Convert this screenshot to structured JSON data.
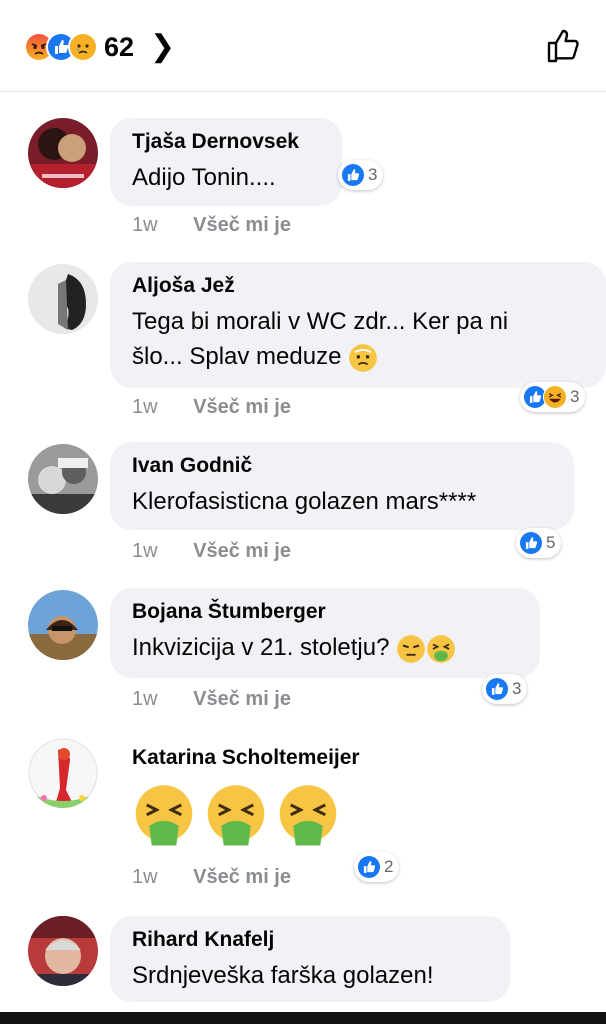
{
  "header": {
    "reaction_icons": [
      "angry-icon",
      "like-icon",
      "sad-icon"
    ],
    "reaction_count": "62",
    "chevron": "❯",
    "like_action_icon": "thumbs-up-outline-icon"
  },
  "comments": [
    {
      "name": "Tjaša Dernovsek",
      "text": "Adijo Tonin....",
      "time": "1w",
      "like_label": "Všeč mi je",
      "reactions": [
        "like-icon"
      ],
      "reaction_count": "3"
    },
    {
      "name": "Aljoša Jež",
      "text_line1": "Tega bi morali v WC zdr... Ker pa ni",
      "text_line2": "šlo... Splav meduze",
      "time": "1w",
      "like_label": "Všeč mi je",
      "reactions": [
        "like-icon",
        "laugh-icon"
      ],
      "reaction_count": "3"
    },
    {
      "name": "Ivan Godnič",
      "text": "Klerofasisticna golazen mars****",
      "time": "1w",
      "like_label": "Všeč mi je",
      "reactions": [
        "like-icon"
      ],
      "reaction_count": "5"
    },
    {
      "name": "Bojana Štumberger",
      "text": "Inkvizicija v 21. stoletju?",
      "time": "1w",
      "like_label": "Všeč mi je",
      "reactions": [
        "like-icon"
      ],
      "reaction_count": "3"
    },
    {
      "name": "Katarina Scholtemeijer",
      "time": "1w",
      "like_label": "Všeč mi je",
      "reactions": [
        "like-icon"
      ],
      "reaction_count": "2"
    },
    {
      "name": "Rihard Knafelj",
      "text": "Srdnjeveška farška golazen!"
    }
  ],
  "colors": {
    "like": "#1877f2",
    "angry": "#f0533c",
    "sad": "#f7b125",
    "bubble": "#f0f2f5",
    "meta": "#8a8d91"
  }
}
